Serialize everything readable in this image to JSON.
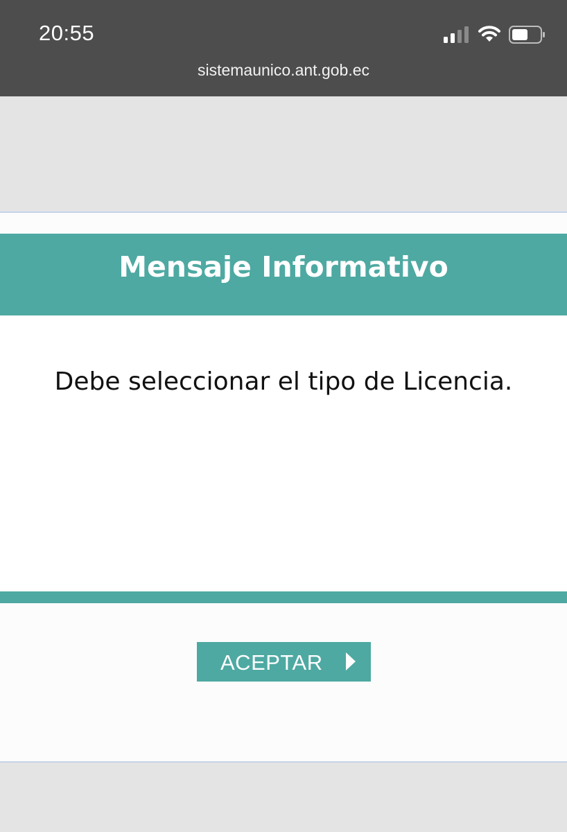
{
  "status_bar": {
    "time": "20:55",
    "url": "sistemaunico.ant.gob.ec",
    "icons": [
      "signal-icon",
      "wifi-icon",
      "battery-icon"
    ]
  },
  "dialog": {
    "title": "Mensaje Informativo",
    "message": "Debe seleccionar el tipo de Licencia.",
    "accept_label": "ACEPTAR",
    "accept_icon": "arrow-right-icon"
  },
  "colors": {
    "status_bar_bg": "#4d4d4d",
    "page_bg": "#e4e4e4",
    "accent": "#4ea9a2",
    "dialog_border": "#c4d2ea"
  }
}
